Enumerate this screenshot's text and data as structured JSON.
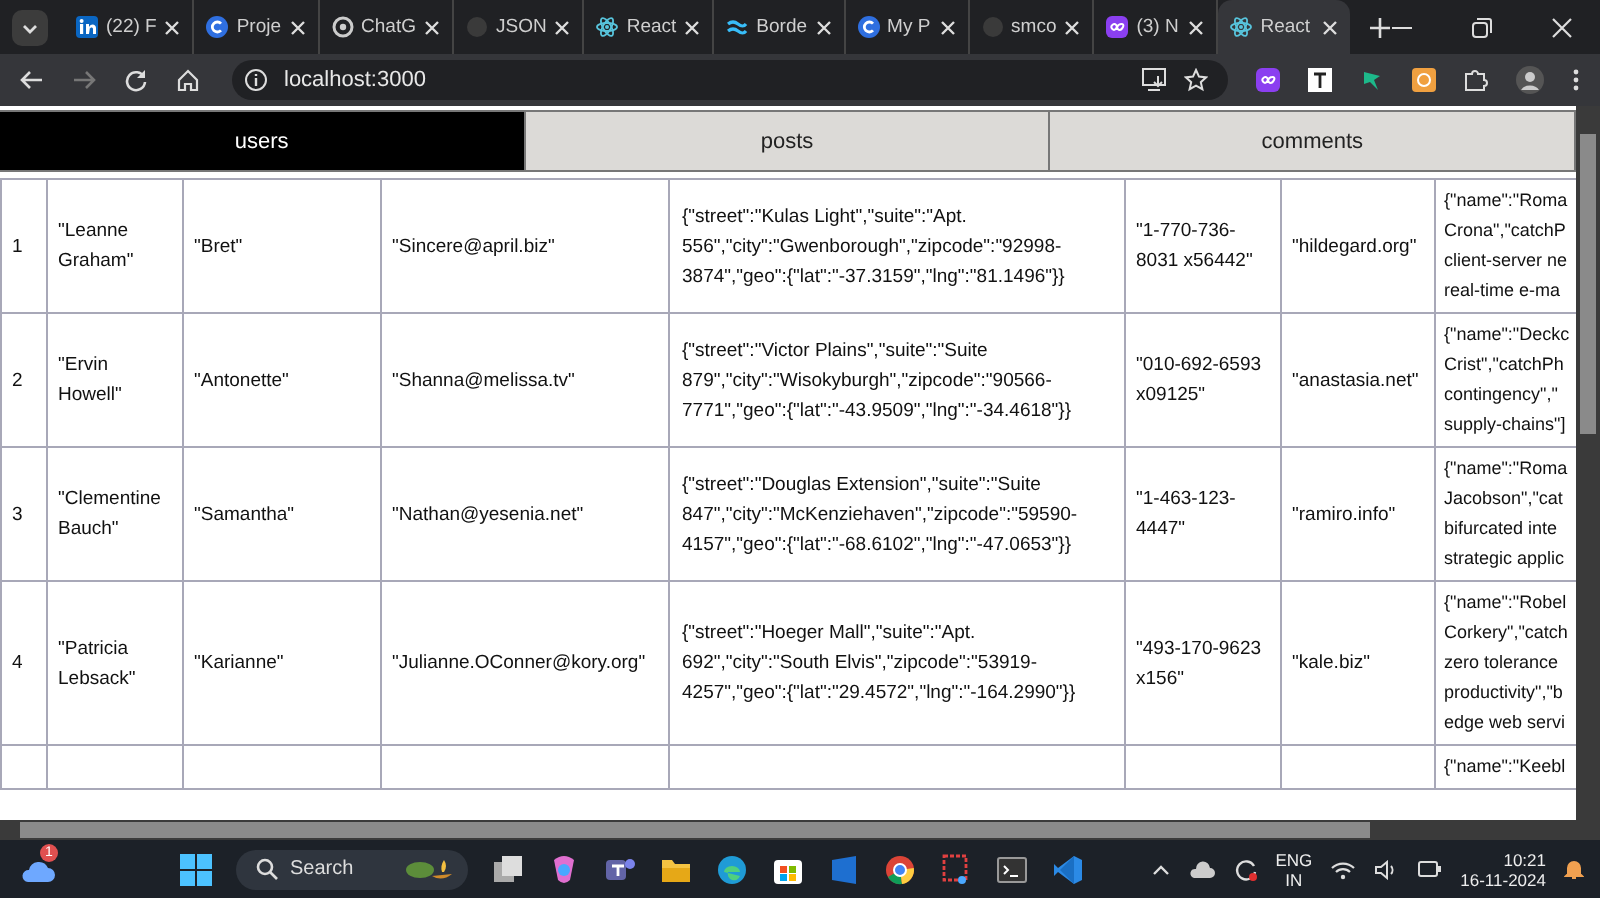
{
  "browser": {
    "tabs": [
      {
        "title": "(22) F",
        "selected": false
      },
      {
        "title": "Proje",
        "selected": false
      },
      {
        "title": "ChatG",
        "selected": false
      },
      {
        "title": "JSON",
        "selected": false
      },
      {
        "title": "React",
        "selected": false
      },
      {
        "title": "Borde",
        "selected": false
      },
      {
        "title": "My P",
        "selected": false
      },
      {
        "title": "smco",
        "selected": false
      },
      {
        "title": "(3) N",
        "selected": false
      },
      {
        "title": "React",
        "selected": true
      }
    ],
    "address": "localhost:3000"
  },
  "app_tabs": [
    {
      "label": "users",
      "selected": true
    },
    {
      "label": "posts",
      "selected": false
    },
    {
      "label": "comments",
      "selected": false
    }
  ],
  "table": {
    "rows": [
      {
        "id": "1",
        "name": "\"Leanne Graham\"",
        "username": "\"Bret\"",
        "email": "\"Sincere@april.biz\"",
        "address": "{\"street\":\"Kulas Light\",\"suite\":\"Apt. 556\",\"city\":\"Gwenborough\",\"zipcode\":\"92998-3874\",\"geo\":{\"lat\":\"-37.3159\",\"lng\":\"81.1496\"}}",
        "phone": "\"1-770-736-8031 x56442\"",
        "website": "\"hildegard.org\"",
        "company": "{\"name\":\"Roma\nCrona\",\"catchP\nclient-server ne\nreal-time e-ma"
      },
      {
        "id": "2",
        "name": "\"Ervin Howell\"",
        "username": "\"Antonette\"",
        "email": "\"Shanna@melissa.tv\"",
        "address": "{\"street\":\"Victor Plains\",\"suite\":\"Suite 879\",\"city\":\"Wisokyburgh\",\"zipcode\":\"90566-7771\",\"geo\":{\"lat\":\"-43.9509\",\"lng\":\"-34.4618\"}}",
        "phone": "\"010-692-6593 x09125\"",
        "website": "\"anastasia.net\"",
        "company": "{\"name\":\"Deckc\nCrist\",\"catchPh\ncontingency\",\"\nsupply-chains\"]"
      },
      {
        "id": "3",
        "name": "\"Clementine Bauch\"",
        "username": "\"Samantha\"",
        "email": "\"Nathan@yesenia.net\"",
        "address": "{\"street\":\"Douglas Extension\",\"suite\":\"Suite 847\",\"city\":\"McKenziehaven\",\"zipcode\":\"59590-4157\",\"geo\":{\"lat\":\"-68.6102\",\"lng\":\"-47.0653\"}}",
        "phone": "\"1-463-123-4447\"",
        "website": "\"ramiro.info\"",
        "company": "{\"name\":\"Roma\nJacobson\",\"cat\nbifurcated inte\nstrategic applic"
      },
      {
        "id": "4",
        "name": "\"Patricia Lebsack\"",
        "username": "\"Karianne\"",
        "email": "\"Julianne.OConner@kory.org\"",
        "address": "{\"street\":\"Hoeger Mall\",\"suite\":\"Apt. 692\",\"city\":\"South Elvis\",\"zipcode\":\"53919-4257\",\"geo\":{\"lat\":\"29.4572\",\"lng\":\"-164.2990\"}}",
        "phone": "\"493-170-9623 x156\"",
        "website": "\"kale.biz\"",
        "company": "{\"name\":\"Robel\nCorkery\",\"catch\nzero tolerance\nproductivity\",\"b\nedge web servi"
      },
      {
        "company": "{\"name\":\"Keebl"
      }
    ]
  },
  "taskbar": {
    "weather_badge": "1",
    "search": "Search",
    "language": "ENG",
    "region": "IN",
    "time": "10:21",
    "date": "16-11-2024"
  }
}
